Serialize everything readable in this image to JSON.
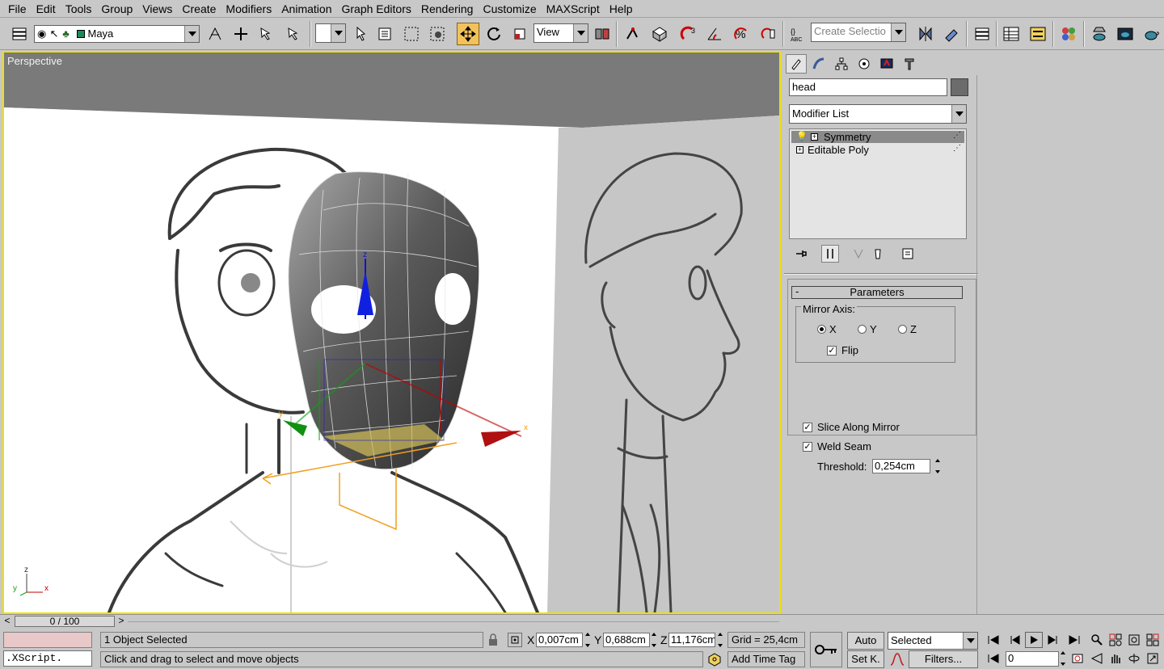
{
  "menu": [
    "File",
    "Edit",
    "Tools",
    "Group",
    "Views",
    "Create",
    "Modifiers",
    "Animation",
    "Graph Editors",
    "Rendering",
    "Customize",
    "MAXScript",
    "Help"
  ],
  "toolbar": {
    "layer_name": "Maya",
    "filter_value": "",
    "reference_coord": "View",
    "named_selection_placeholder": "Create Selectio"
  },
  "viewport": {
    "label": "Perspective",
    "gizmo_axes": {
      "x": "x",
      "y": "y",
      "z": "z"
    },
    "corner_axes": {
      "x": "x",
      "y": "y",
      "z": "z"
    }
  },
  "command_panel": {
    "object_name": "head",
    "object_color": "#6c6c6c",
    "modifier_list": "Modifier List",
    "stack": [
      {
        "label": "Symmetry",
        "selected": true
      },
      {
        "label": "Editable Poly",
        "selected": false
      }
    ],
    "parameters": {
      "title": "Parameters",
      "mirror_axis_label": "Mirror Axis:",
      "axes": [
        "X",
        "Y",
        "Z"
      ],
      "selected_axis": "X",
      "flip_label": "Flip",
      "flip": true,
      "slice_label": "Slice Along Mirror",
      "slice": true,
      "weld_label": "Weld Seam",
      "weld": true,
      "threshold_label": "Threshold:",
      "threshold_value": "0,254cm"
    }
  },
  "timeline": {
    "frame_label": "0 / 100",
    "prev": "<",
    "next": ">"
  },
  "status": {
    "script_text": ".XScript.",
    "selection_text": "1 Object Selected",
    "prompt_text": "Click and drag to select and move objects",
    "x_label": "X",
    "x_value": "0,007cm",
    "y_label": "Y",
    "y_value": "0,688cm",
    "z_label": "Z",
    "z_value": "11,176cm",
    "grid_text": "Grid = 25,4cm",
    "add_time_tag": "Add Time Tag",
    "auto_key": "Auto",
    "set_key": "Set K.",
    "key_filter_value": "Selected",
    "filters_label": "Filters...",
    "current_frame": "0"
  },
  "colors": {
    "active_viewport_border": "#f0e000",
    "active_tool": "#f2c25a",
    "ui_background": "#c8c8c8"
  }
}
